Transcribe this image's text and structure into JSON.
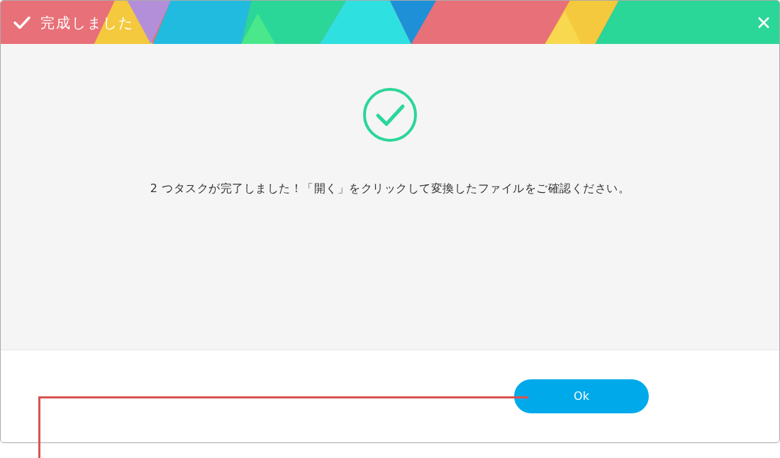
{
  "window": {
    "title": "完成しました"
  },
  "message": "2 つタスクが完了しました！「開く」をクリックして変換したファイルをご確認ください。",
  "buttons": [
    {
      "label": "Ok"
    }
  ]
}
